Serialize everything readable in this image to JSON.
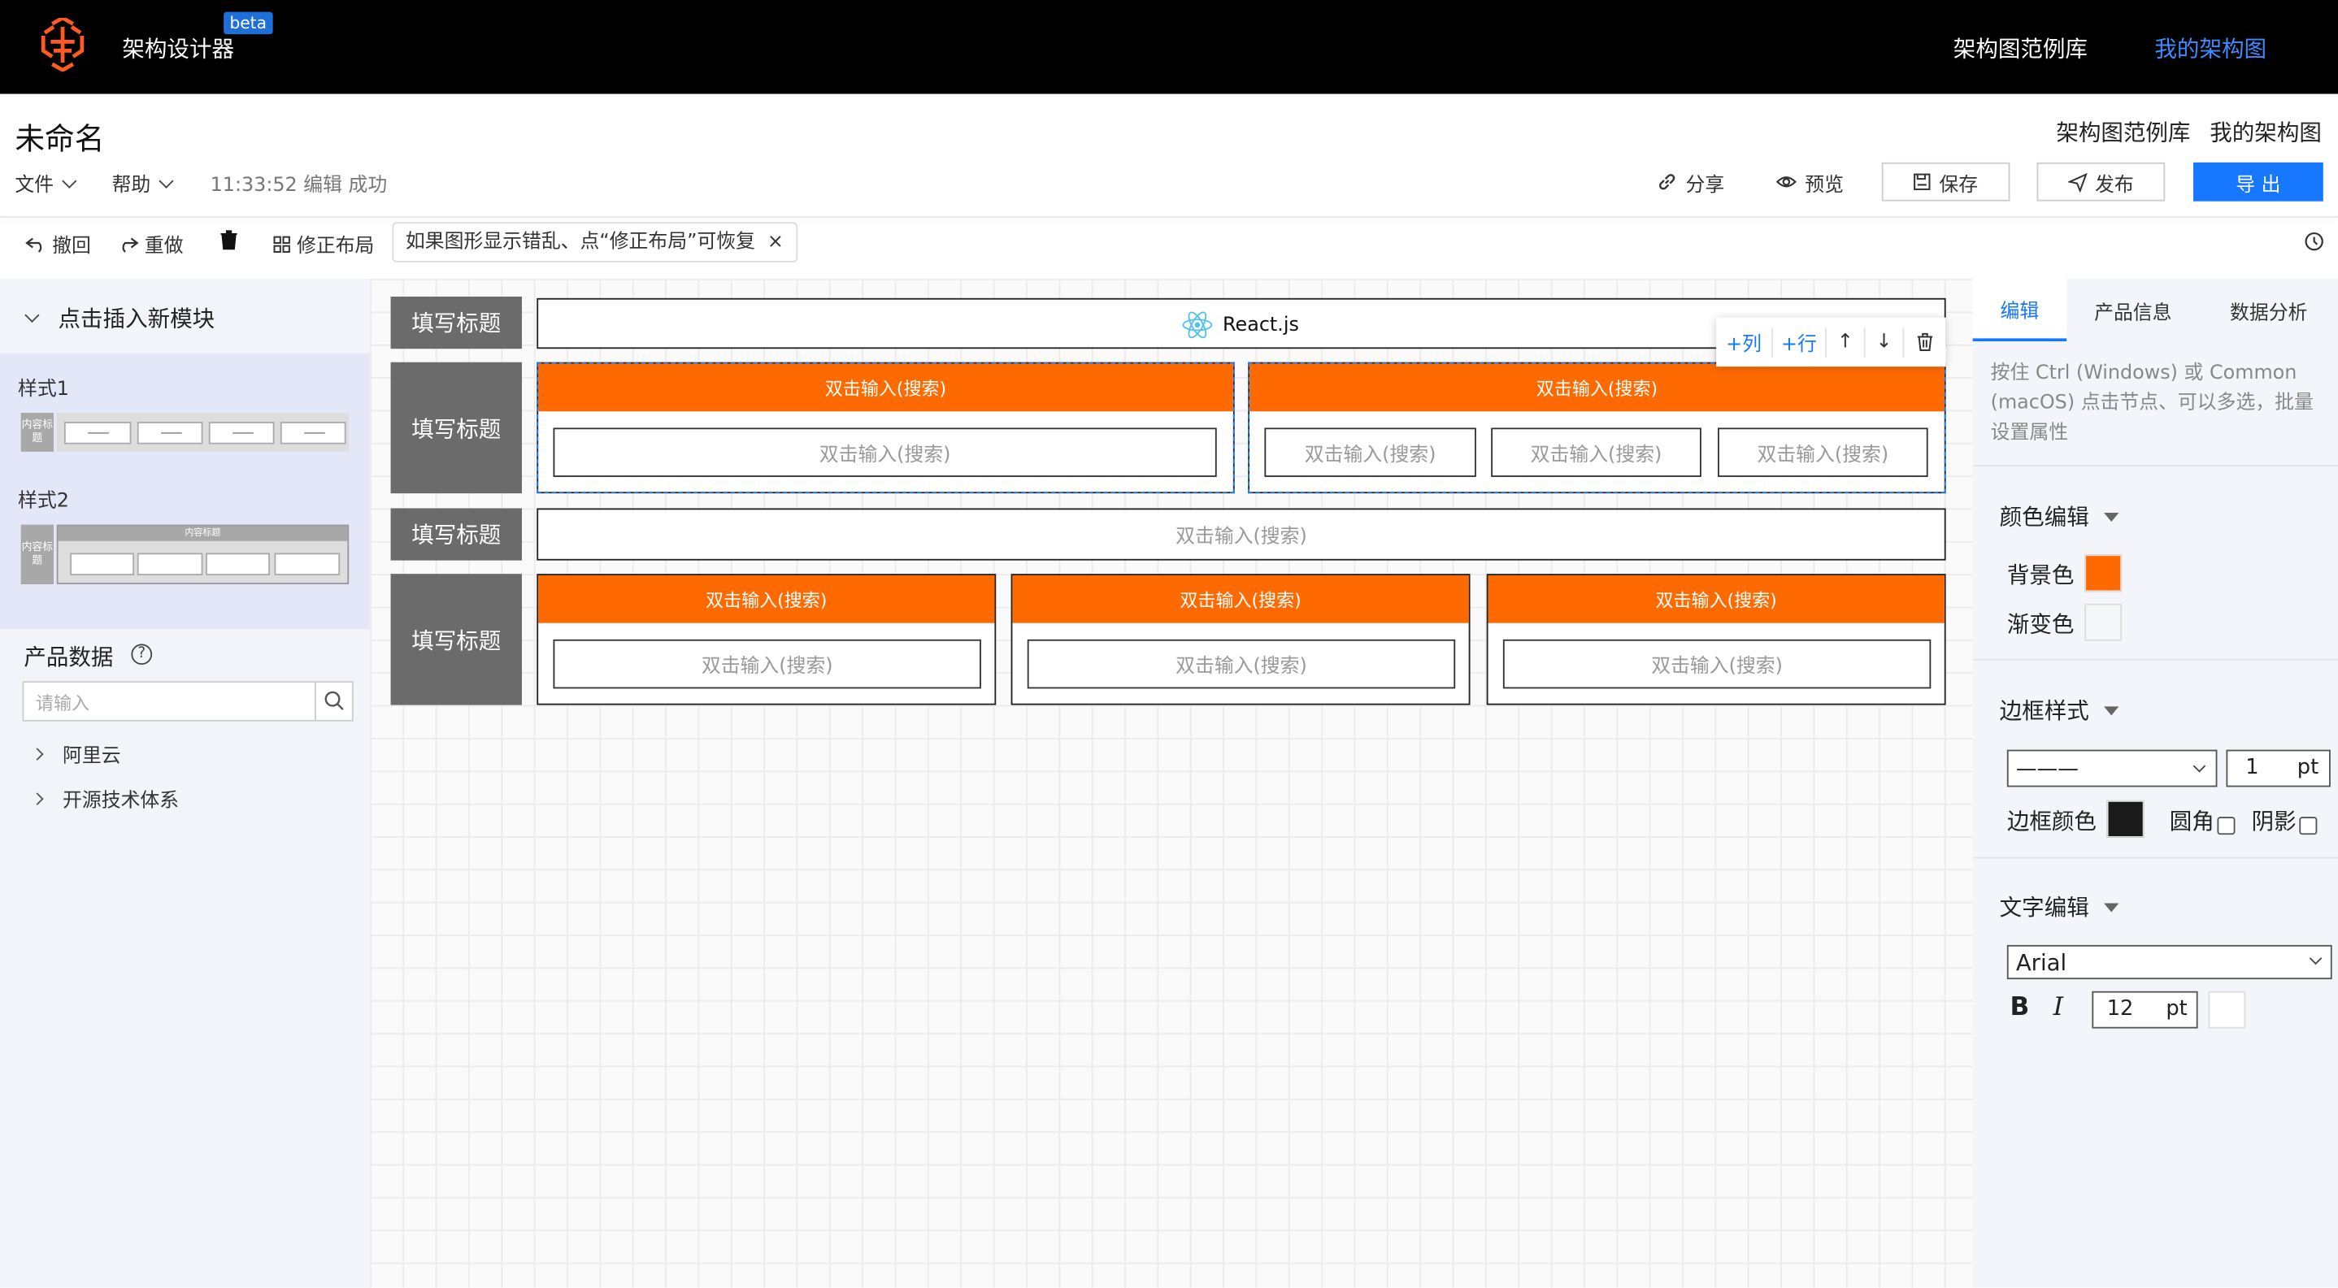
{
  "topbar": {
    "app_name": "架构设计器",
    "beta": "beta",
    "links": [
      "架构图范例库",
      "我的架构图"
    ]
  },
  "header": {
    "doc_title": "未命名",
    "menus": [
      "文件",
      "帮助"
    ],
    "status": "11:33:52 编辑 成功",
    "links": [
      "架构图范例库",
      "我的架构图"
    ],
    "actions": {
      "share": "分享",
      "preview": "预览",
      "save": "保存",
      "publish": "发布",
      "export": "导 出"
    }
  },
  "toolbar": {
    "undo": "撤回",
    "redo": "重做",
    "fix_layout": "修正布局",
    "tip": "如果图形显示错乱、点“修正布局”可恢复",
    "tip_close": "×"
  },
  "left": {
    "insert_title": "点击插入新模块",
    "styles": [
      {
        "label": "样式1"
      },
      {
        "label": "样式2"
      }
    ],
    "mini_side_label": "内容标题",
    "mini_top_label": "内容标题",
    "product_title": "产品数据",
    "help": "?",
    "search_placeholder": "请输入",
    "tree": [
      "阿里云",
      "开源技术体系"
    ]
  },
  "canvas": {
    "row_title": "填写标题",
    "header_label": "React.js",
    "cell_text": "双击输入(搜索)",
    "float_toolbar": {
      "add_col": "+列",
      "add_row": "+行",
      "up": "↑",
      "down": "↓"
    }
  },
  "right": {
    "tabs": [
      "编辑",
      "产品信息",
      "数据分析"
    ],
    "active_tab": "编辑",
    "hint": "按住 Ctrl (Windows) 或 Common (macOS) 点击节点、可以多选，批量设置属性",
    "color_section": "颜色编辑",
    "bg_label": "背景色",
    "bg_color": "#ff6a00",
    "gradient_label": "渐变色",
    "border_section": "边框样式",
    "border_style": "———",
    "border_width": "1",
    "unit": "pt",
    "border_color_label": "边框颜色",
    "border_color": "#1a1a1a",
    "radius_label": "圆角",
    "shadow_label": "阴影",
    "text_section": "文字编辑",
    "font": "Arial",
    "bold": "B",
    "italic": "I",
    "font_size": "12"
  },
  "colors": {
    "accent": "#1677ff",
    "orange": "#ff6a00",
    "title_gray": "#6b6b6b"
  }
}
